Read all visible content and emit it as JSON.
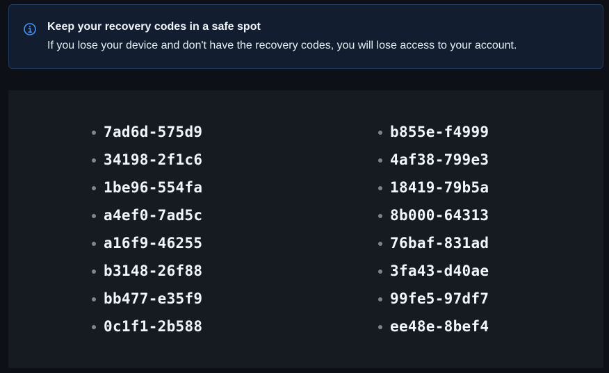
{
  "notice": {
    "icon": "info-icon",
    "title": "Keep your recovery codes in a safe spot",
    "text": "If you lose your device and don't have the recovery codes, you will lose access to your account."
  },
  "recovery_codes": {
    "left": [
      "7ad6d-575d9",
      "34198-2f1c6",
      "1be96-554fa",
      "a4ef0-7ad5c",
      "a16f9-46255",
      "b3148-26f88",
      "bb477-e35f9",
      "0c1f1-2b588"
    ],
    "right": [
      "b855e-f4999",
      "4af38-799e3",
      "18419-79b5a",
      "8b000-64313",
      "76baf-831ad",
      "3fa43-d40ae",
      "99fe5-97df7",
      "ee48e-8bef4"
    ]
  },
  "colors": {
    "accent": "#4493f8",
    "background": "#0d1117",
    "panel": "#161b22"
  }
}
